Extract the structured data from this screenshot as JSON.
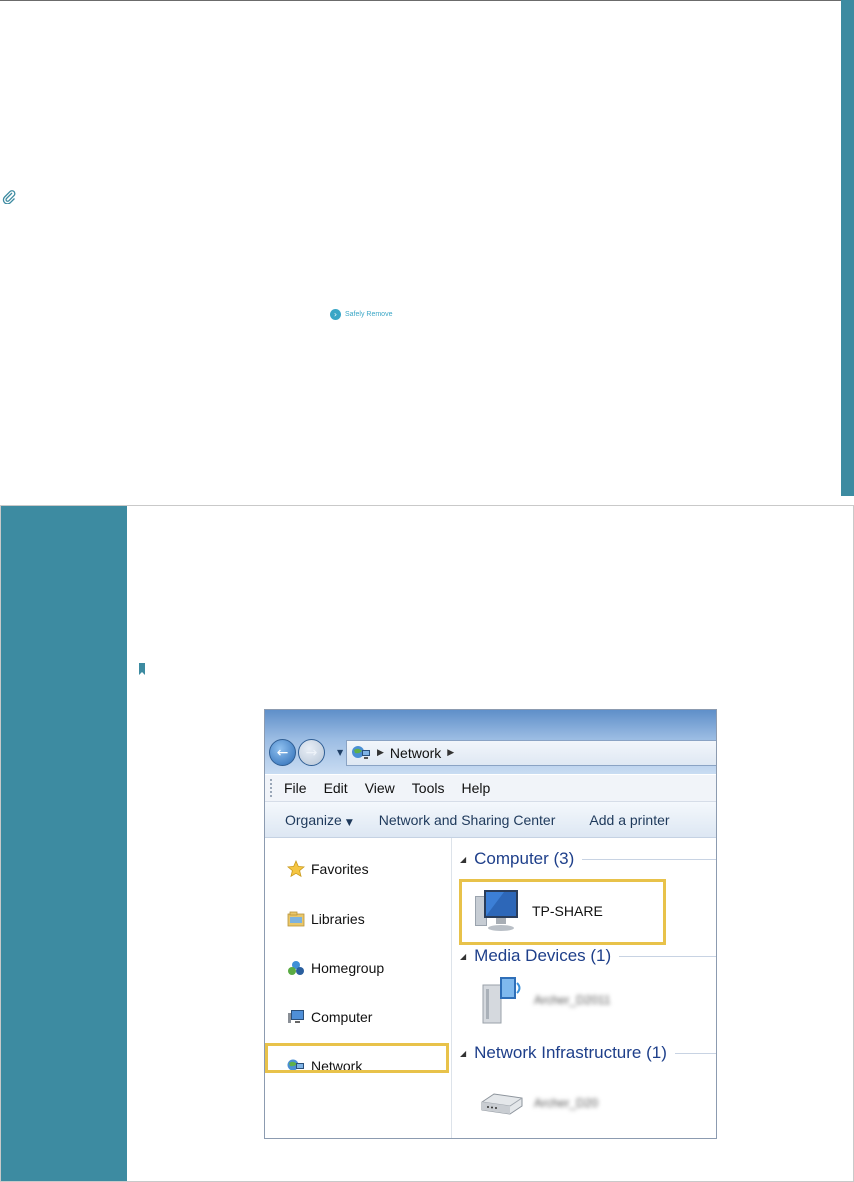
{
  "page": {
    "safely_remove_label": "Safely Remove",
    "accent_color": "#3d8ba1"
  },
  "window": {
    "address": {
      "crumb": "Network"
    },
    "menu": [
      "File",
      "Edit",
      "View",
      "Tools",
      "Help"
    ],
    "commands": {
      "organize": "Organize",
      "sharing": "Network and Sharing Center",
      "printer": "Add a printer"
    },
    "nav": {
      "favorites": "Favorites",
      "libraries": "Libraries",
      "homegroup": "Homegroup",
      "computer": "Computer",
      "network": "Network"
    },
    "groups": {
      "computer": "Computer (3)",
      "media": "Media Devices (1)",
      "infra": "Network Infrastructure (1)"
    },
    "items": {
      "tp_share": "TP-SHARE",
      "media_device": "Archer_D2011",
      "router": "Archer_D20"
    },
    "highlight_color": "#e8c24a"
  }
}
